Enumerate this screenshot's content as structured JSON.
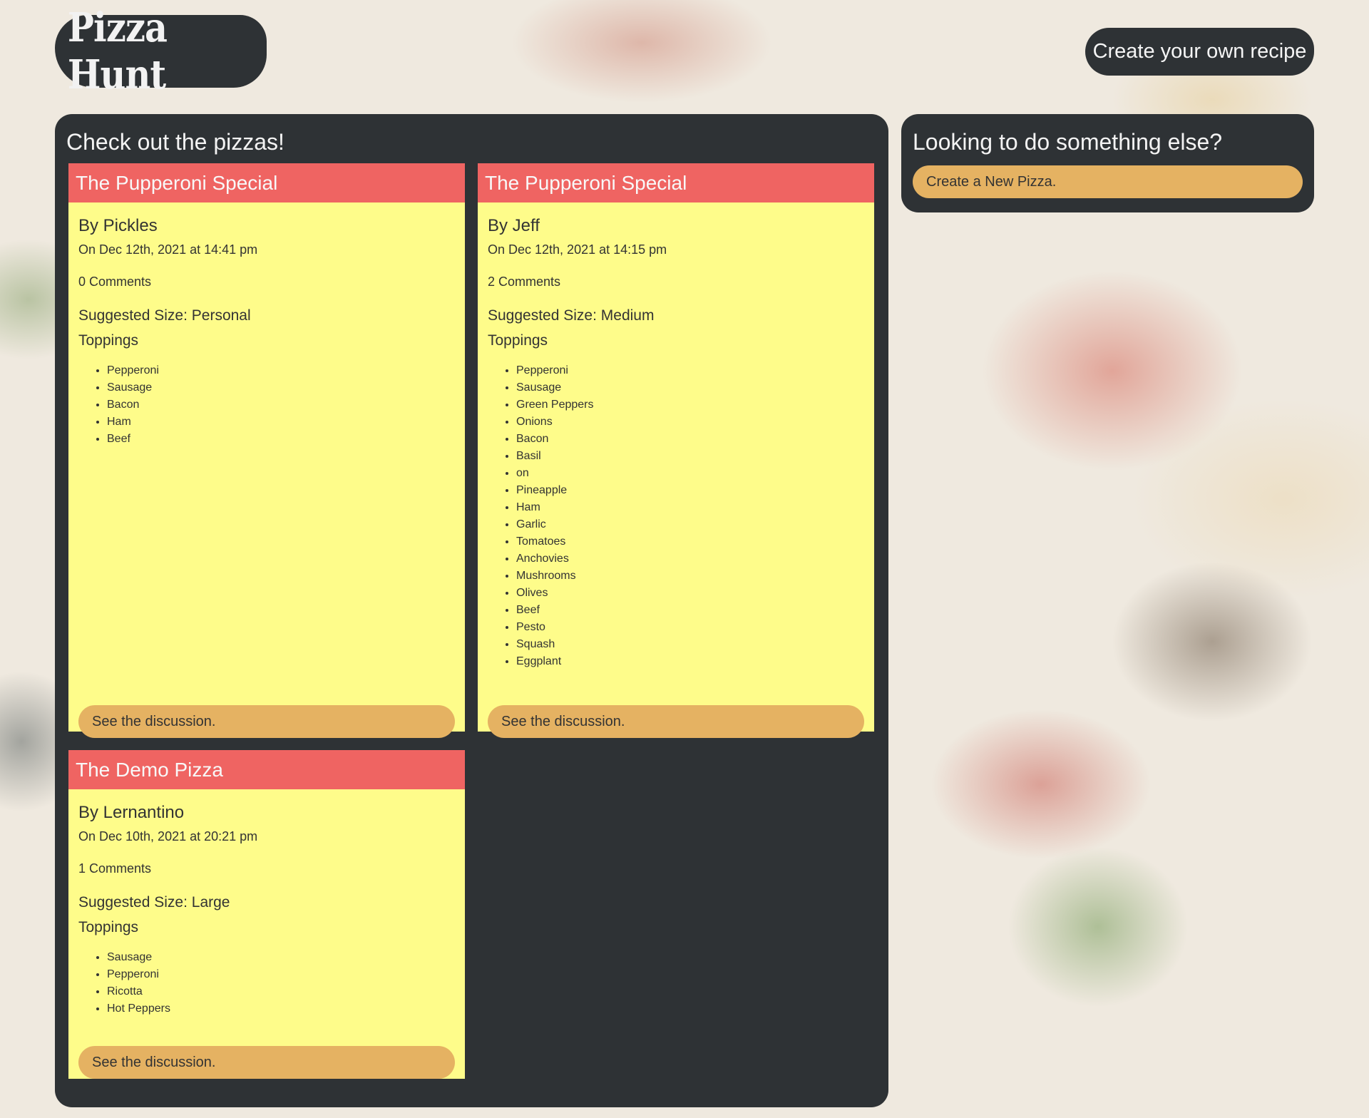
{
  "header": {
    "logo_text": "Pizza Hunt",
    "create_recipe_label": "Create your own recipe"
  },
  "main": {
    "title": "Check out the pizzas!",
    "pizzas": [
      {
        "name": "The Pupperoni Special",
        "author": "By Pickles",
        "date": "On Dec 12th, 2021 at 14:41 pm",
        "comments": "0 Comments",
        "size": "Suggested Size: Personal",
        "toppings_label": "Toppings",
        "toppings": [
          "Pepperoni",
          "Sausage",
          "Bacon",
          "Ham",
          "Beef"
        ],
        "discussion_label": "See the discussion."
      },
      {
        "name": "The Pupperoni Special",
        "author": "By Jeff",
        "date": "On Dec 12th, 2021 at 14:15 pm",
        "comments": "2 Comments",
        "size": "Suggested Size: Medium",
        "toppings_label": "Toppings",
        "toppings": [
          "Pepperoni",
          "Sausage",
          "Green Peppers",
          "Onions",
          "Bacon",
          "Basil",
          "on",
          "Pineapple",
          "Ham",
          "Garlic",
          "Tomatoes",
          "Anchovies",
          "Mushrooms",
          "Olives",
          "Beef",
          "Pesto",
          "Squash",
          "Eggplant"
        ],
        "discussion_label": "See the discussion."
      },
      {
        "name": "The Demo Pizza",
        "author": "By Lernantino",
        "date": "On Dec 10th, 2021 at 20:21 pm",
        "comments": "1 Comments",
        "size": "Suggested Size: Large",
        "toppings_label": "Toppings",
        "toppings": [
          "Sausage",
          "Pepperoni",
          "Ricotta",
          "Hot Peppers"
        ],
        "discussion_label": "See the discussion."
      }
    ]
  },
  "sidebar": {
    "title": "Looking to do something else?",
    "new_pizza_label": "Create a New Pizza."
  },
  "colors": {
    "panel": "#2e3235",
    "card_header": "#ef6462",
    "card_body": "#fefc8a",
    "button": "#e5b262"
  }
}
